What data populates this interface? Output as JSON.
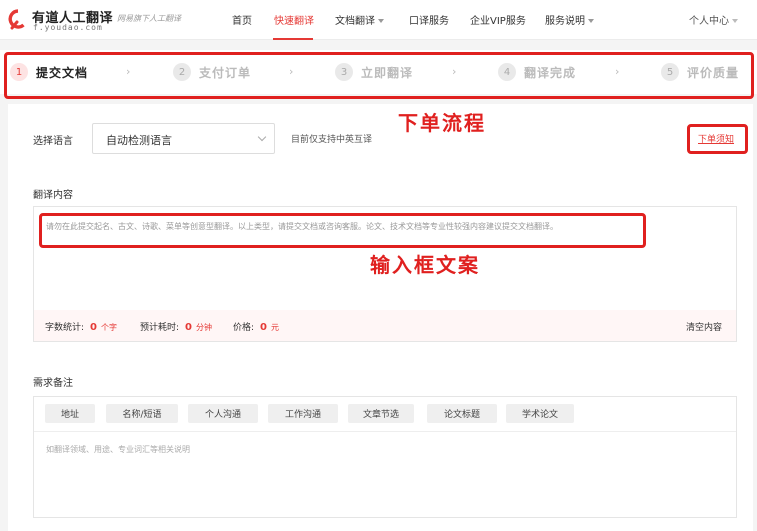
{
  "header": {
    "logo_title": "有道人工翻译",
    "logo_sub": "f.youdao.com",
    "slogan": "网易旗下人工翻译",
    "nav": [
      "首页",
      "快速翻译",
      "文档翻译",
      "口译服务",
      "企业VIP服务",
      "服务说明"
    ],
    "active_nav": "快速翻译",
    "user_center": "个人中心"
  },
  "steps": [
    {
      "num": "1",
      "label": "提交文档"
    },
    {
      "num": "2",
      "label": "支付订单"
    },
    {
      "num": "3",
      "label": "立即翻译"
    },
    {
      "num": "4",
      "label": "翻译完成"
    },
    {
      "num": "5",
      "label": "评价质量"
    }
  ],
  "step_arrow": "›",
  "annotations": {
    "order_flow": "下单流程",
    "input_copy": "输入框文案"
  },
  "language": {
    "label": "选择语言",
    "selected": "自动检测语言",
    "note": "目前仅支持中英互译",
    "order_notice": "下单须知"
  },
  "content": {
    "title": "翻译内容",
    "placeholder": "请勿在此提交起名、古文、诗歌、菜单等创意型翻译。以上类型，请提交文档或咨询客服。论文、技术文档等专业性较强内容建议提交文档翻译。",
    "stats": {
      "word_count_label": "字数统计:",
      "word_count_value": "0",
      "word_count_unit": "个字",
      "time_label": "预计耗时:",
      "time_value": "0",
      "time_unit": "分钟",
      "price_label": "价格:",
      "price_value": "0",
      "price_unit": "元"
    },
    "clear": "清空内容"
  },
  "requirements": {
    "title": "需求备注",
    "tags": [
      "地址",
      "名称/短语",
      "个人沟通",
      "工作沟通",
      "文章节选",
      "论文标题",
      "学术论文"
    ],
    "placeholder": "如翻译领域、用途、专业词汇等相关说明"
  },
  "colors": {
    "accent": "#e53935",
    "annotation": "#e0201f"
  }
}
